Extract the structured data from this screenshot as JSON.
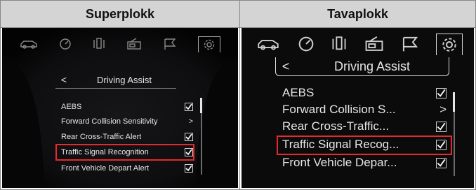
{
  "panels": [
    {
      "header": "Superplokk",
      "menu_title": "Driving Assist",
      "back_symbol": "<",
      "items": [
        {
          "label": "AEBS",
          "control": "check",
          "checked": true
        },
        {
          "label": "Forward Collision Sensitivity",
          "control": "arrow",
          "symbol": ">"
        },
        {
          "label": "Rear Cross-Traffic Alert",
          "control": "check",
          "checked": true
        },
        {
          "label": "Traffic Signal Recognition",
          "control": "check",
          "checked": true,
          "highlighted": true
        },
        {
          "label": "Front Vehicle Depart Alert",
          "control": "check",
          "checked": true
        }
      ],
      "tab_icons": [
        "car-icon",
        "gauge-icon",
        "seat-icon",
        "radio-icon",
        "flag-icon",
        "gear-icon"
      ],
      "active_tab": "gear-icon"
    },
    {
      "header": "Tavaplokk",
      "menu_title": "Driving Assist",
      "back_symbol": "<",
      "items": [
        {
          "label": "AEBS",
          "control": "check",
          "checked": true
        },
        {
          "label": "Forward Collision S...",
          "control": "arrow",
          "symbol": ">"
        },
        {
          "label": "Rear Cross-Traffic...",
          "control": "check",
          "checked": true
        },
        {
          "label": "Traffic Signal Recog...",
          "control": "check",
          "checked": true,
          "highlighted": true
        },
        {
          "label": "Front Vehicle Depar...",
          "control": "check",
          "checked": true
        }
      ],
      "tab_icons": [
        "car-icon",
        "gauge-icon",
        "seat-icon",
        "radio-icon",
        "flag-icon",
        "gear-icon"
      ],
      "active_tab": "gear-icon"
    }
  ],
  "colors": {
    "highlight": "#e42a2a",
    "screen_bg": "#0b0b0c",
    "header_bg": "#d4d4d4"
  }
}
